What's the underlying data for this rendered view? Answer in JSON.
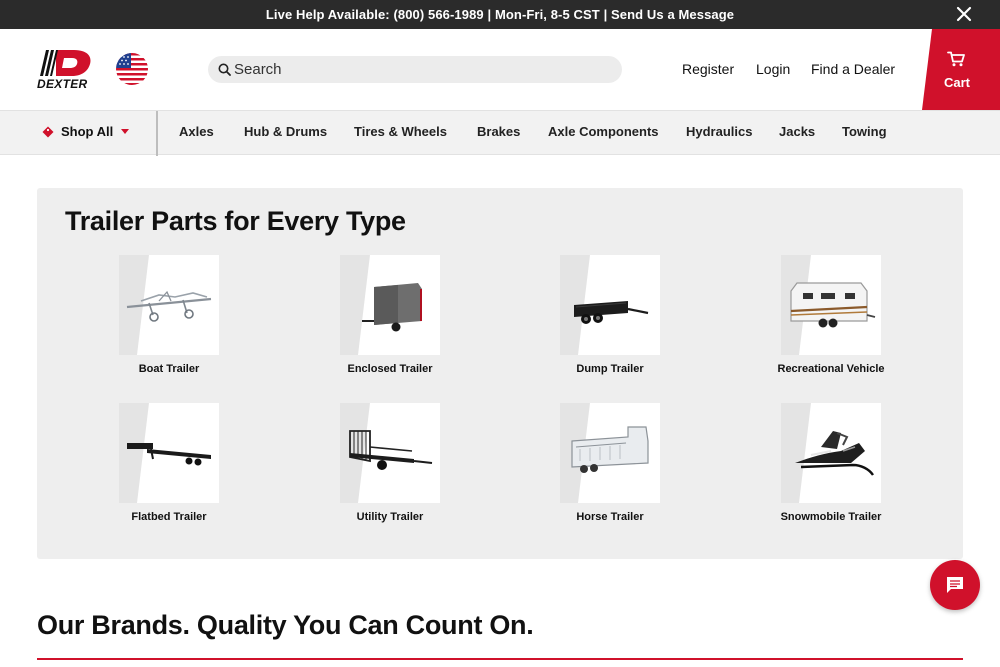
{
  "topbar": {
    "help_label": "Live Help Available:",
    "phone": "(800) 566-1989",
    "hours": "Mon-Fri, 8-5 CST",
    "message_link": "Send Us a Message"
  },
  "header": {
    "logo_text": "DEXTER",
    "search_placeholder": "Search",
    "links": {
      "register": "Register",
      "login": "Login",
      "dealer": "Find a Dealer"
    },
    "cart_label": "Cart"
  },
  "nav": {
    "shop_all": "Shop All",
    "items": [
      "Axles",
      "Hub & Drums",
      "Tires & Wheels",
      "Brakes",
      "Axle Components",
      "Hydraulics",
      "Jacks",
      "Towing"
    ]
  },
  "trailer_section": {
    "title": "Trailer Parts for Every Type",
    "types": [
      {
        "label": "Boat Trailer",
        "icon": "boat-trailer-icon"
      },
      {
        "label": "Enclosed Trailer",
        "icon": "enclosed-trailer-icon"
      },
      {
        "label": "Dump Trailer",
        "icon": "dump-trailer-icon"
      },
      {
        "label": "Recreational Vehicle",
        "icon": "rv-icon"
      },
      {
        "label": "Flatbed Trailer",
        "icon": "flatbed-trailer-icon"
      },
      {
        "label": "Utility Trailer",
        "icon": "utility-trailer-icon"
      },
      {
        "label": "Horse Trailer",
        "icon": "horse-trailer-icon"
      },
      {
        "label": "Snowmobile Trailer",
        "icon": "snowmobile-icon"
      }
    ]
  },
  "brands": {
    "title": "Our Brands. Quality You Can Count On."
  },
  "colors": {
    "brand_red": "#d0112b",
    "topbar": "#2b2b2b",
    "panel": "#eeeeee"
  }
}
